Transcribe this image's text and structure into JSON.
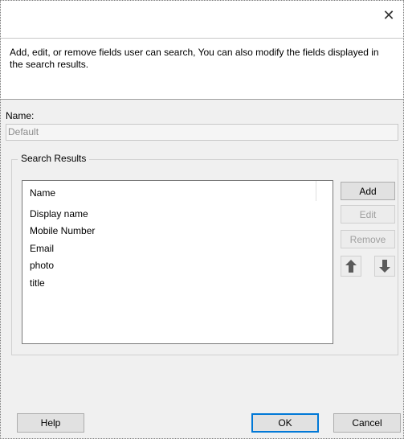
{
  "window": {
    "close_glyph": "✕"
  },
  "description": "Add, edit, or remove fields user can search,  You can also modify the fields displayed in the search results.",
  "name_field": {
    "label": "Name:",
    "value": "Default"
  },
  "search_results": {
    "group_label": "Search Results",
    "column_header": "Name",
    "items": [
      "Display name",
      "Mobile Number",
      "Email",
      "photo",
      "title"
    ]
  },
  "side_buttons": {
    "add": "Add",
    "edit": "Edit",
    "remove": "Remove",
    "move_up_icon": "arrow-up-icon",
    "move_down_icon": "arrow-down-icon"
  },
  "footer": {
    "help": "Help",
    "ok": "OK",
    "cancel": "Cancel"
  },
  "colors": {
    "accent": "#0078d7",
    "disabled_text": "#a0a0a0",
    "arrow_fill": "#5a5a5a"
  }
}
